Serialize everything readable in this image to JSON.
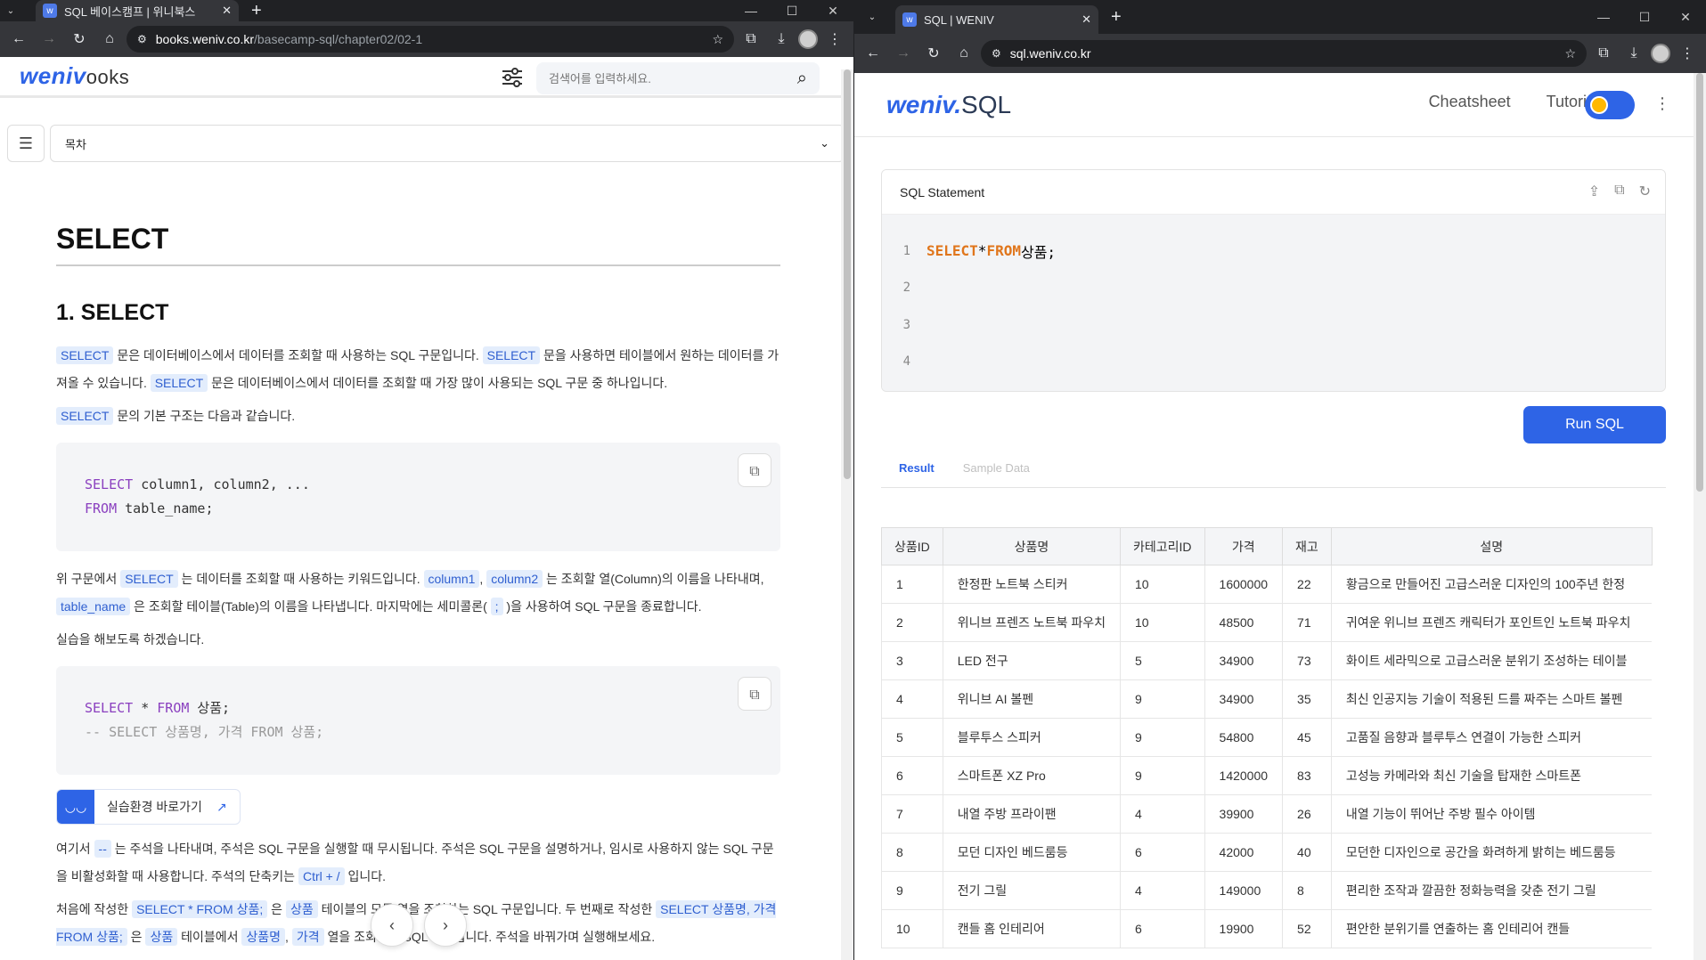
{
  "left": {
    "tab_title": "SQL 베이스캠프 | 위니북스",
    "url_host": "books.weniv.co.kr",
    "url_path": "/basecamp-sql/chapter02/02-1",
    "logo_main": "weniv",
    "logo_suffix": "ooks",
    "search_placeholder": "검색어를 입력하세요.",
    "toc_label": "목차",
    "h1": "SELECT",
    "h2": "1. SELECT",
    "p1": {
      "k1": "SELECT",
      "t1": " 문은 데이터베이스에서 데이터를 조회할 때 사용하는 SQL 구문입니다. ",
      "k2": "SELECT",
      "t2": " 문을 사용하면 테이블에서 원하는 데이터를 가져올 수 있습니다. ",
      "k3": "SELECT",
      "t3": " 문은 데이터베이스에서 데이터를 조회할 때 가장 많이 사용되는 SQL 구문 중 하나입니다."
    },
    "p2": {
      "k1": "SELECT",
      "t1": " 문의 기본 구조는 다음과 같습니다."
    },
    "code1": {
      "kw1": "SELECT",
      "l1": " column1, column2, ...",
      "kw2": "FROM",
      "l2": " table_name;"
    },
    "p3": {
      "t0": "위 구문에서 ",
      "k1": "SELECT",
      "t1": " 는 데이터를 조회할 때 사용하는 키워드입니다. ",
      "k2": "column1",
      "t2": ", ",
      "k3": "column2",
      "t3": " 는 조회할 열(Column)의 이름을 나타내며, ",
      "k4": "table_name",
      "t4": " 은 조회할 테이블(Table)의 이름을 나타냅니다. 마지막에는 세미콜론( ",
      "k5": ";",
      "t5": " )을 사용하여 SQL 구문을 종료합니다."
    },
    "p4": "실습을 해보도록 하겠습니다.",
    "code2": {
      "kw1": "SELECT",
      "l1a": " * ",
      "kw2": "FROM",
      "l1b": " 상품;",
      "comment": "-- SELECT 상품명, 가격 FROM 상품;"
    },
    "practice_label": "실습환경 바로가기",
    "p5": {
      "t0": "여기서 ",
      "k1": "--",
      "t1": " 는 주석을 나타내며, 주석은 SQL 구문을 실행할 때 무시됩니다. 주석은 SQL 구문을 설명하거나, 임시로 사용하지 않는 SQL 구문을 비활성화할 때 사용합니다. 주석의 단축키는 ",
      "k2": "Ctrl + /",
      "t2": " 입니다."
    },
    "p6": {
      "t0": "처음에 작성한 ",
      "k1": "SELECT * FROM 상품;",
      "t1": " 은 ",
      "k2": "상품",
      "t2": " 테이블의 모든 열을 조회하는 SQL 구문입니다. 두 번째로 작성한 ",
      "k3": "SELECT 상품명, 가격 FROM 상품;",
      "t3": " 은 ",
      "k4": "상품",
      "t4": " 테이블에서 ",
      "k5": "상품명",
      "t5": ", ",
      "k6": "가격",
      "t6": " 열을 조회하는 SQL 구문입니다. 주석을 바꿔가며 실행해보세요."
    }
  },
  "right": {
    "tab_title": "SQL | WENIV",
    "url": "sql.weniv.co.kr",
    "logo_main": "weniv.",
    "logo_suffix": "SQL",
    "nav": {
      "cheatsheet": "Cheatsheet",
      "tutorial": "Tutorial"
    },
    "statement_title": "SQL Statement",
    "editor": {
      "kw1": "SELECT",
      "op": " * ",
      "kw2": "FROM",
      "rest": " 상품;"
    },
    "line_numbers": [
      "1",
      "2",
      "3",
      "4"
    ],
    "run_label": "Run SQL",
    "tabs": {
      "result": "Result",
      "sample": "Sample Data"
    },
    "columns": [
      "상품ID",
      "상품명",
      "카테고리ID",
      "가격",
      "재고",
      "설명"
    ],
    "rows": [
      [
        "1",
        "한정판 노트북 스티커",
        "10",
        "1600000",
        "22",
        "황금으로 만들어진 고급스러운 디자인의 100주년 한정"
      ],
      [
        "2",
        "위니브 프렌즈 노트북 파우치",
        "10",
        "48500",
        "71",
        "귀여운 위니브 프렌즈 캐릭터가 포인트인 노트북 파우치"
      ],
      [
        "3",
        "LED 전구",
        "5",
        "34900",
        "73",
        "화이트 세라믹으로 고급스러운 분위기 조성하는 테이블"
      ],
      [
        "4",
        "위니브 AI 볼펜",
        "9",
        "34900",
        "35",
        "최신 인공지능 기술이 적용된 드를 짜주는 스마트 볼펜"
      ],
      [
        "5",
        "블루투스 스피커",
        "9",
        "54800",
        "45",
        "고품질 음향과 블루투스 연결이 가능한 스피커"
      ],
      [
        "6",
        "스마트폰 XZ Pro",
        "9",
        "1420000",
        "83",
        "고성능 카메라와 최신 기술을 탑재한 스마트폰"
      ],
      [
        "7",
        "내열 주방 프라이팬",
        "4",
        "39900",
        "26",
        "내열 기능이 뛰어난 주방 필수 아이템"
      ],
      [
        "8",
        "모던 디자인 베드룸등",
        "6",
        "42000",
        "40",
        "모던한 디자인으로 공간을 화려하게 밝히는 베드룸등"
      ],
      [
        "9",
        "전기 그릴",
        "4",
        "149000",
        "8",
        "편리한 조작과 깔끔한 정화능력을 갖춘 전기 그릴"
      ],
      [
        "10",
        "캔들 홈 인테리어",
        "6",
        "19900",
        "52",
        "편안한 분위기를 연출하는 홈 인테리어 캔들"
      ]
    ]
  }
}
